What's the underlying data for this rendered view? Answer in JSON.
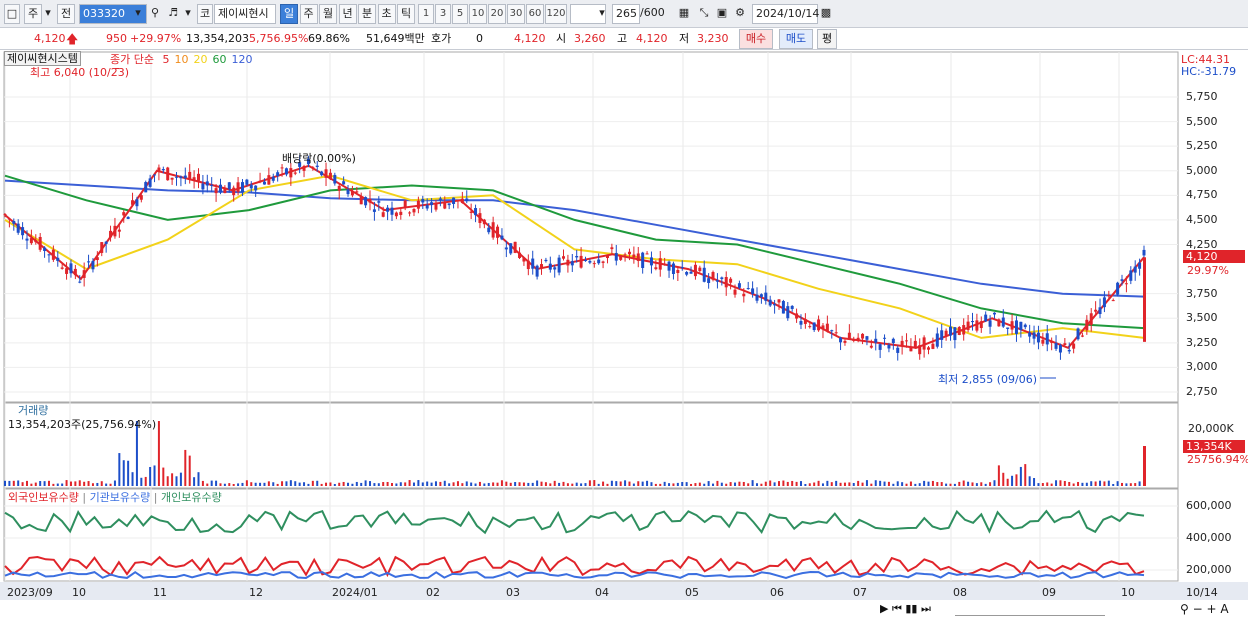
{
  "toolbar": {
    "market_code_btn": "주",
    "prev_btn": "전",
    "stock_code": "033320",
    "market_tag": "코",
    "stock_name": "제이씨현시",
    "periods": [
      "일",
      "주",
      "월",
      "년",
      "분",
      "초",
      "틱"
    ],
    "active_period": "일",
    "minute_units": [
      "1",
      "3",
      "5",
      "10",
      "20",
      "30",
      "60",
      "120"
    ],
    "view_count": "265",
    "view_total": "/600",
    "date": "2024/10/14"
  },
  "quote": {
    "price": "4,120",
    "change": "950",
    "change_pct": "+29.97%",
    "volume": "13,354,203",
    "volume_ratio": "5,756.95%",
    "turnover": "69.86%",
    "amount": "51,649백만",
    "ask_label": "호가",
    "ask_value": "0",
    "ask_price": "4,120",
    "open_label": "시",
    "open": "3,260",
    "high_label": "고",
    "high": "4,120",
    "low_label": "저",
    "low": "3,230",
    "buy_btn": "매수",
    "sell_btn": "매도",
    "eval_btn": "평"
  },
  "price_panel": {
    "stock_tag": "제이씨현시스템",
    "ma_label": "종가 단순",
    "ma_periods": [
      "5",
      "10",
      "20",
      "60",
      "120"
    ],
    "ma_colors": [
      "#e0242a",
      "#f08c1c",
      "#f2d21a",
      "#1f9a3c",
      "#3b5fd6"
    ],
    "high_marker": "최고 6,040 (10/23)",
    "low_marker": "최저 2,855 (09/06)",
    "dividend_marker": "배당락(0.00%)",
    "lc": "LC:44.31",
    "hc": "HC:-31.79",
    "last_price": "4,120",
    "last_change": "29.97%",
    "y_ticks": [
      "5,750",
      "5,500",
      "5,250",
      "5,000",
      "4,750",
      "4,500",
      "4,250",
      "3,750",
      "3,500",
      "3,250",
      "3,000",
      "2,750"
    ]
  },
  "volume_panel": {
    "title": "거래량",
    "value_text": "13,354,203주(25,756.94%)",
    "y_tick": "20,000K",
    "last_value": "13,354K",
    "last_pct": "25756.94%"
  },
  "holdings_panel": {
    "series": [
      {
        "name": "외국인보유수량",
        "color": "#e0242a"
      },
      {
        "name": "기관보유수량",
        "color": "#3b6fe0"
      },
      {
        "name": "개인보유수량",
        "color": "#2f8f5f"
      }
    ],
    "y_ticks": [
      "600,000",
      "400,000",
      "200,000"
    ]
  },
  "x_axis": {
    "labels": [
      "2023/09",
      "10",
      "11",
      "12",
      "2024/01",
      "02",
      "03",
      "04",
      "05",
      "06",
      "07",
      "08",
      "09",
      "10"
    ],
    "last_date": "10/14"
  },
  "chart_data": {
    "type": "line",
    "title": "",
    "xlabel": "",
    "ylabel": "",
    "ylim": [
      2750,
      6000
    ],
    "months": [
      "2023/09",
      "10",
      "11",
      "12",
      "2024/01",
      "02",
      "03",
      "04",
      "05",
      "06",
      "07",
      "08",
      "09",
      "10"
    ],
    "series": [
      {
        "name": "5",
        "values": [
          4550,
          3900,
          5000,
          4800,
          5050,
          4600,
          4700,
          4000,
          4150,
          4000,
          3700,
          3300,
          3200,
          3500,
          3200,
          4120
        ]
      },
      {
        "name": "20",
        "values": [
          4500,
          4000,
          4300,
          4800,
          4950,
          4700,
          4750,
          4200,
          4100,
          4050,
          3800,
          3600,
          3300,
          3400,
          3300
        ]
      },
      {
        "name": "60",
        "values": [
          4950,
          4700,
          4500,
          4600,
          4800,
          4850,
          4800,
          4500,
          4300,
          4250,
          4050,
          3850,
          3600,
          3450,
          3400
        ]
      },
      {
        "name": "120",
        "values": [
          4900,
          4850,
          4800,
          4780,
          4720,
          4700,
          4700,
          4600,
          4450,
          4300,
          4150,
          4000,
          3850,
          3750,
          3720
        ]
      }
    ],
    "last_close": 4120,
    "period_high": 6040,
    "period_low": 2855
  }
}
